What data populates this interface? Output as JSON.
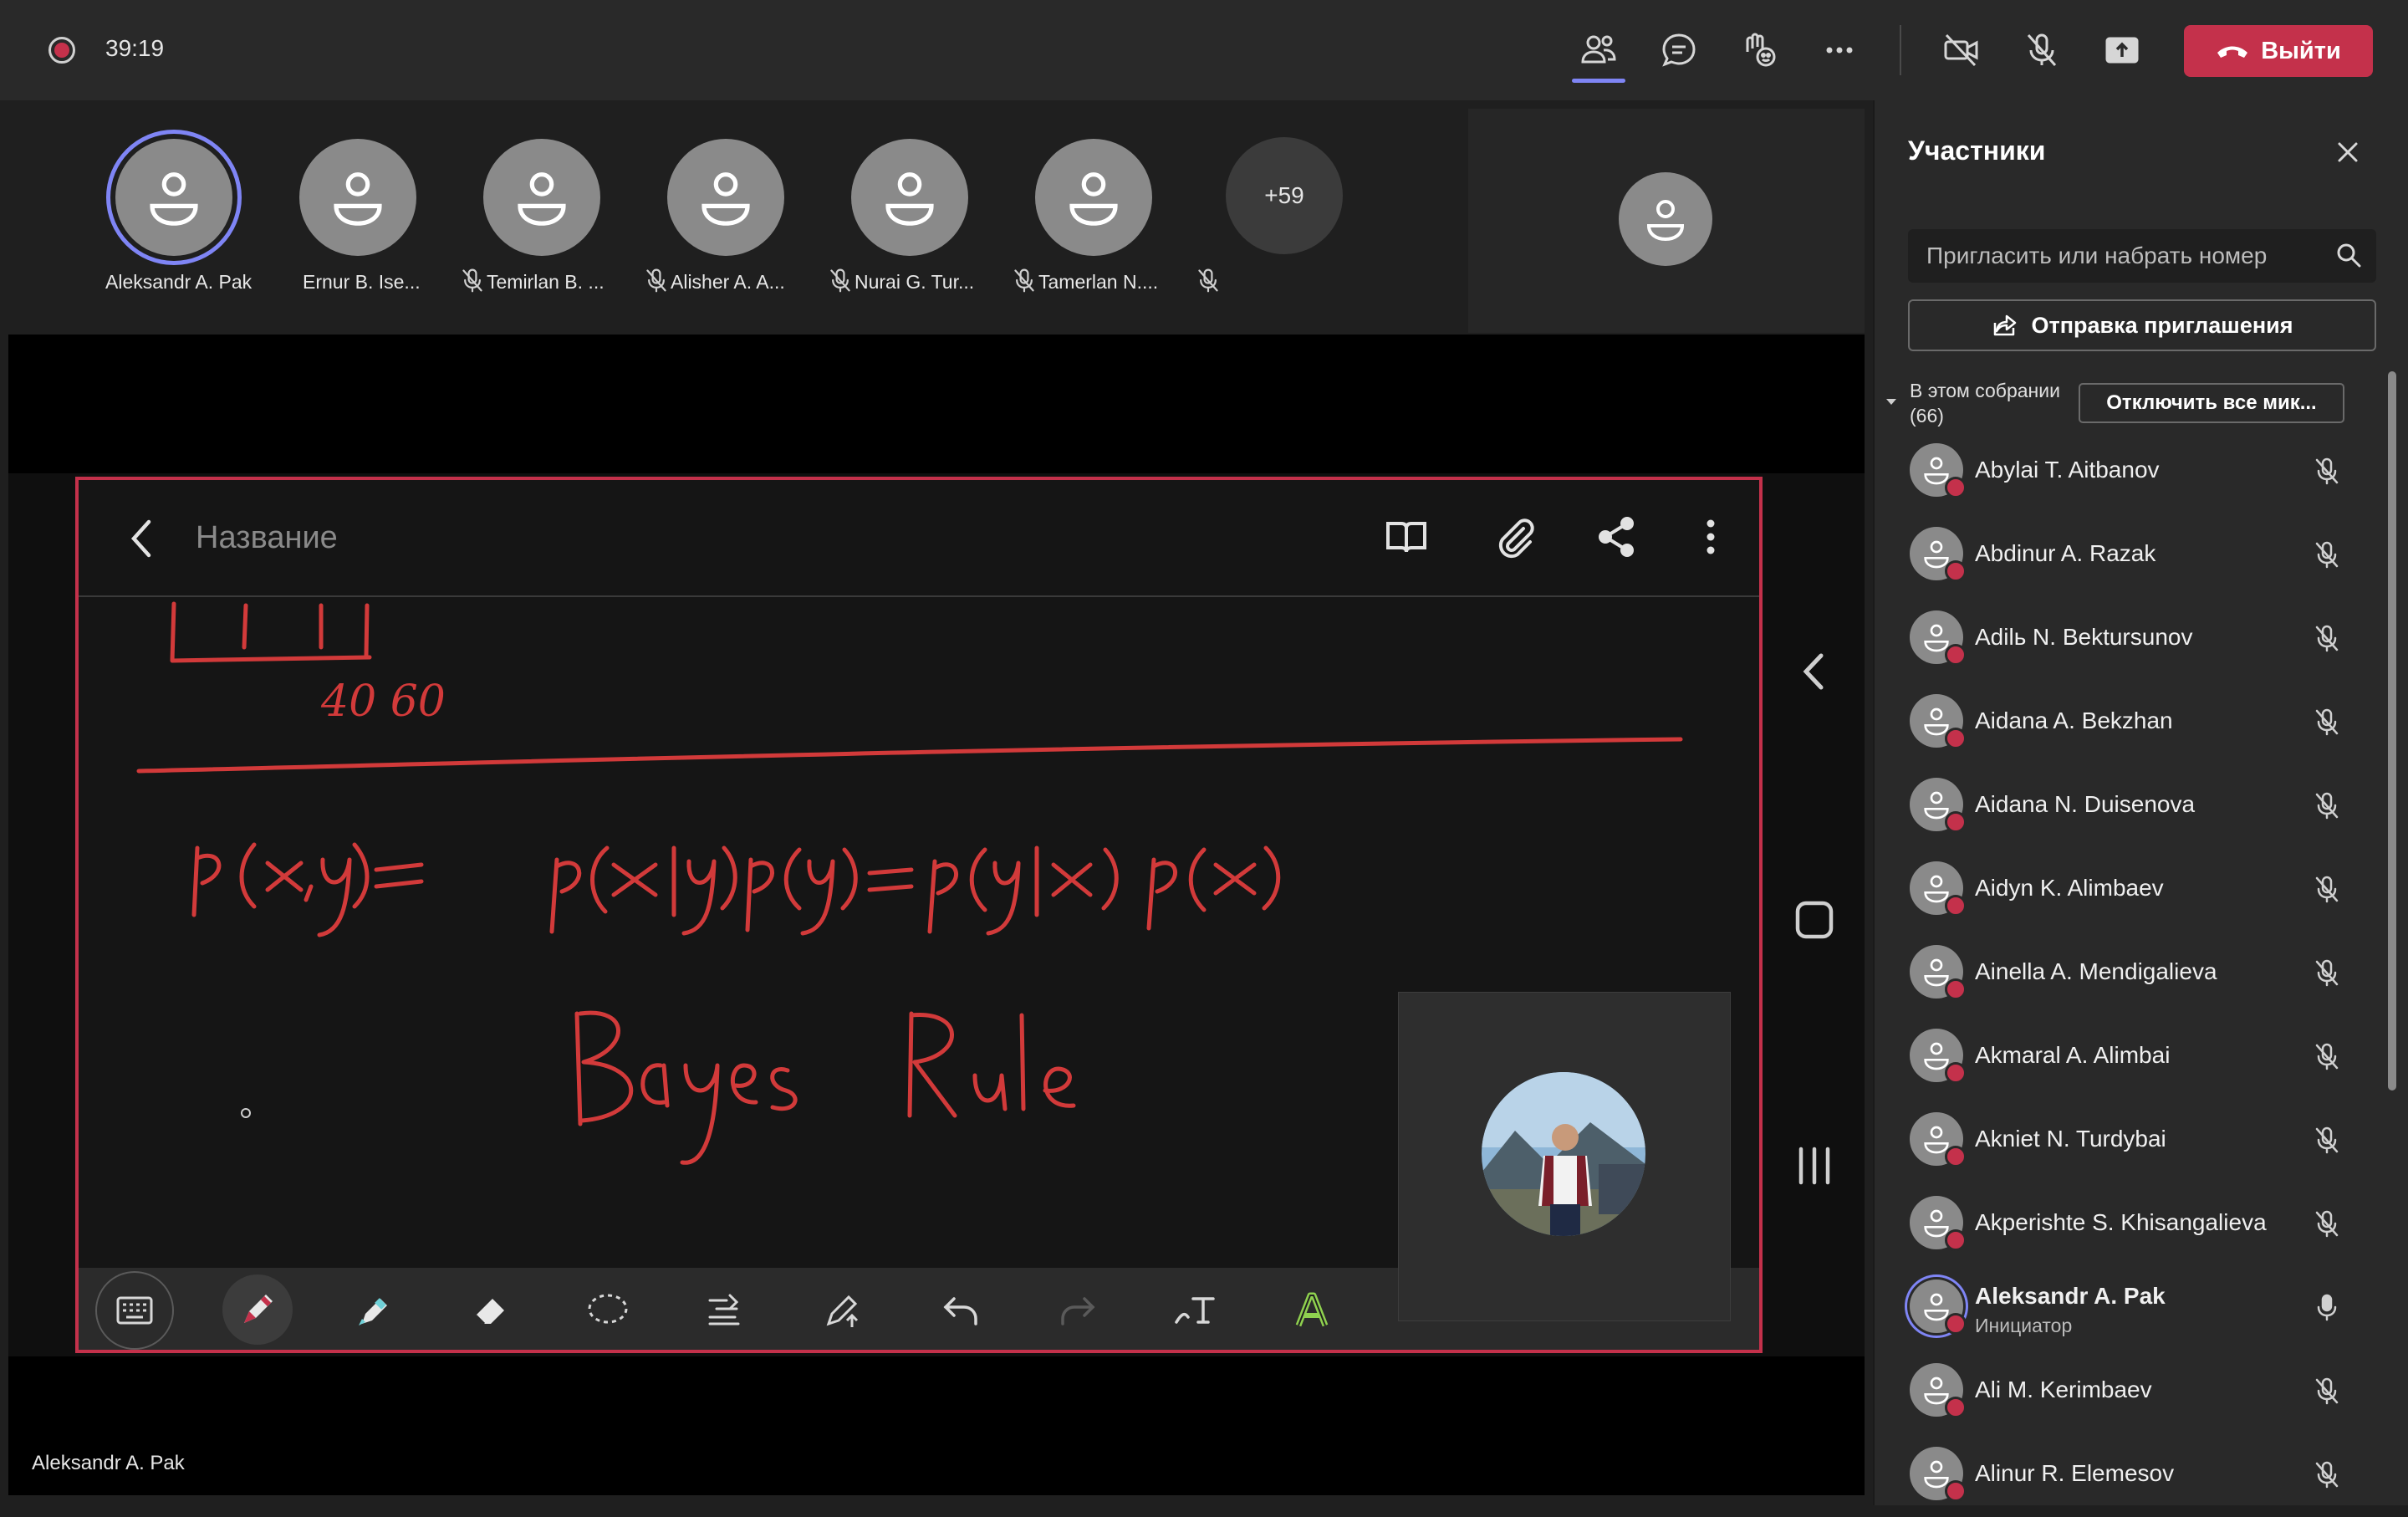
{
  "call": {
    "timer": "39:19",
    "leave_label": "Выйти"
  },
  "strip": {
    "participants": [
      {
        "name": "Aleksandr A. Pak"
      },
      {
        "name": "Ernur B. Ise..."
      },
      {
        "name": "Temirlan B. ..."
      },
      {
        "name": "Alisher A. A..."
      },
      {
        "name": "Nurai G. Tur..."
      },
      {
        "name": "Tamerlan N...."
      }
    ],
    "more_count": "+59"
  },
  "stage": {
    "presenter_name": "Aleksandr A. Pak"
  },
  "app": {
    "title_placeholder": "Название",
    "handwriting": {
      "numbers": "40   60",
      "formula": "p(x,y) = p(x|y)p(y) = p(y|x) p(x)",
      "caption": "Bayes Rule"
    },
    "icons": [
      "back-icon",
      "book-icon",
      "attachment-icon",
      "share-icon",
      "more-vertical-icon"
    ],
    "tools": [
      "keyboard-icon",
      "pen-icon",
      "highlighter-icon",
      "eraser-icon",
      "lasso-icon",
      "align-icon",
      "pen-settings-icon",
      "undo-icon",
      "redo-icon",
      "text-icon",
      "color-icon"
    ]
  },
  "panel": {
    "title": "Участники",
    "invite_placeholder": "Пригласить или набрать номер",
    "send_invite_label": "Отправка приглашения",
    "section_label_line1": "В этом собрании",
    "section_label_line2": "(66)",
    "mute_all_label": "Отключить все мик...",
    "members": [
      {
        "name": "Abylai T. Aitbanov",
        "role": "",
        "muted": true
      },
      {
        "name": "Abdinur A. Razak",
        "role": "",
        "muted": true
      },
      {
        "name": "Adilь N. Bektursunov",
        "role": "",
        "muted": true
      },
      {
        "name": "Aidana A. Bekzhan",
        "role": "",
        "muted": true
      },
      {
        "name": "Aidana N. Duisenova",
        "role": "",
        "muted": true
      },
      {
        "name": "Aidyn K. Alimbaev",
        "role": "",
        "muted": true
      },
      {
        "name": "Ainella A. Mendigalieva",
        "role": "",
        "muted": true
      },
      {
        "name": "Akmaral A. Alimbai",
        "role": "",
        "muted": true
      },
      {
        "name": "Akniet N. Turdybai",
        "role": "",
        "muted": true
      },
      {
        "name": "Akperishte S. Khisangalieva",
        "role": "",
        "muted": true
      },
      {
        "name": "Aleksandr A. Pak",
        "role": "Инициатор",
        "muted": false
      },
      {
        "name": "Ali M. Kerimbaev",
        "role": "",
        "muted": true
      },
      {
        "name": "Alinur R. Elemesov",
        "role": "",
        "muted": true
      }
    ]
  },
  "colors": {
    "accent": "#7f85f5",
    "leave": "#c4314b",
    "ink": "#d23a3a"
  }
}
